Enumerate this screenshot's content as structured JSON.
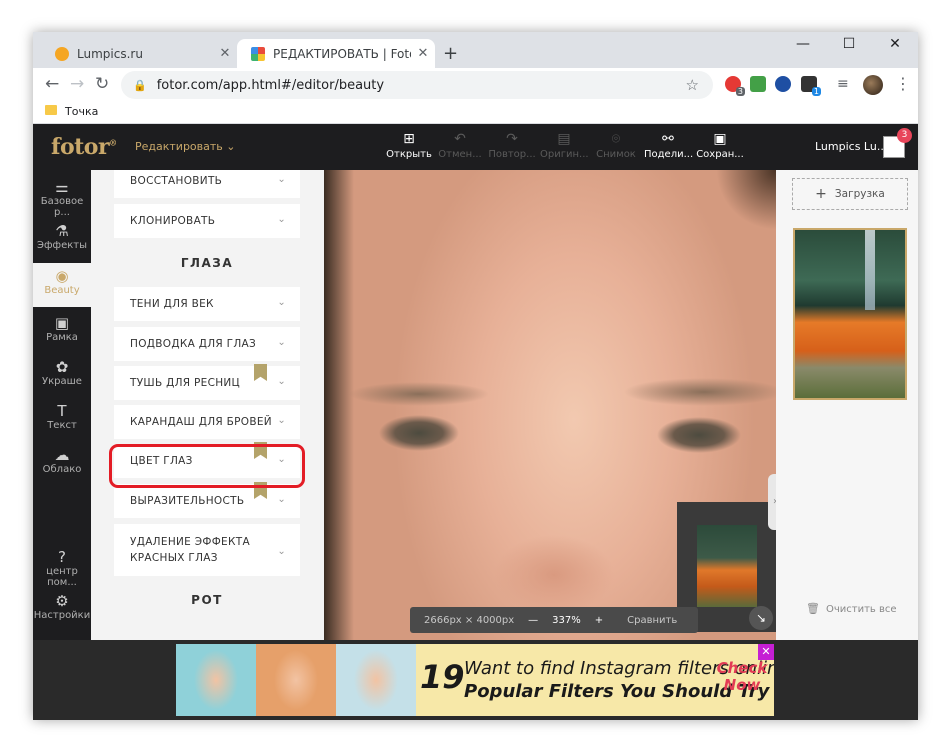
{
  "browser": {
    "tabs": [
      {
        "title": "Lumpics.ru",
        "close": "✕"
      },
      {
        "title": "РЕДАКТИРОВАТЬ | Fotor",
        "close": "✕"
      }
    ],
    "new_tab": "+",
    "window_controls": {
      "minimize": "—",
      "maximize": "☐",
      "close": "✕"
    },
    "url": "fotor.com/app.html#/editor/beauty",
    "bookmark": "Точка",
    "ext_badges": [
      "3",
      "1"
    ]
  },
  "app": {
    "logo": "fotor",
    "logo_mark": "®",
    "edit_menu": "Редактировать ⌄",
    "tools": [
      {
        "label": "Открыть",
        "icon": "⊞"
      },
      {
        "label": "Отмен...",
        "icon": "↶"
      },
      {
        "label": "Повтор...",
        "icon": "↷"
      },
      {
        "label": "Оригин...",
        "icon": "▤"
      },
      {
        "label": "Снимок",
        "icon": "⌾"
      },
      {
        "label": "Подели...",
        "icon": "⚯"
      },
      {
        "label": "Сохран...",
        "icon": "▣"
      }
    ],
    "user": "Lumpics Lu...",
    "notifications": "3"
  },
  "leftnav": [
    {
      "label": "Базовое р...",
      "icon": "⚌"
    },
    {
      "label": "Эффекты",
      "icon": "⚗"
    },
    {
      "label": "Beauty",
      "icon": "◉"
    },
    {
      "label": "Рамка",
      "icon": "▣"
    },
    {
      "label": "Украше",
      "icon": "✿"
    },
    {
      "label": "Текст",
      "icon": "T"
    },
    {
      "label": "Облако",
      "icon": "☁"
    },
    {
      "label": "центр пом...",
      "icon": "?"
    },
    {
      "label": "Настройки",
      "icon": "⚙"
    }
  ],
  "panel": {
    "top_items": [
      "ВОССТАНОВИТЬ",
      "КЛОНИРОВАТЬ"
    ],
    "eyes_title": "ГЛАЗА",
    "eyes_items": [
      "ТЕНИ ДЛЯ ВЕК",
      "ПОДВОДКА ДЛЯ ГЛАЗ",
      "ТУШЬ ДЛЯ РЕСНИЦ",
      "КАРАНДАШ ДЛЯ БРОВЕЙ",
      "ЦВЕТ ГЛАЗ",
      "ВЫРАЗИТЕЛЬНОСТЬ"
    ],
    "red_eye_line1": "УДАЛЕНИЕ ЭФФЕКТА",
    "red_eye_line2": "КРАСНЫХ ГЛАЗ",
    "mouth_title": "РОТ",
    "chevron": "⌄"
  },
  "canvas": {
    "dimensions": "2666px × 4000px",
    "zoom_out": "—",
    "zoom": "337%",
    "zoom_in": "+",
    "compare": "Сравнить",
    "expand": "↘"
  },
  "rightpanel": {
    "upload": "Загрузка",
    "clear_all": "Очистить все"
  },
  "ad": {
    "number": "19",
    "line1": "Want to find Instagram filters online?",
    "line2": "Popular Filters You Should Try",
    "cta_line1": "Check",
    "cta_line2": "Now",
    "close": "✕"
  }
}
